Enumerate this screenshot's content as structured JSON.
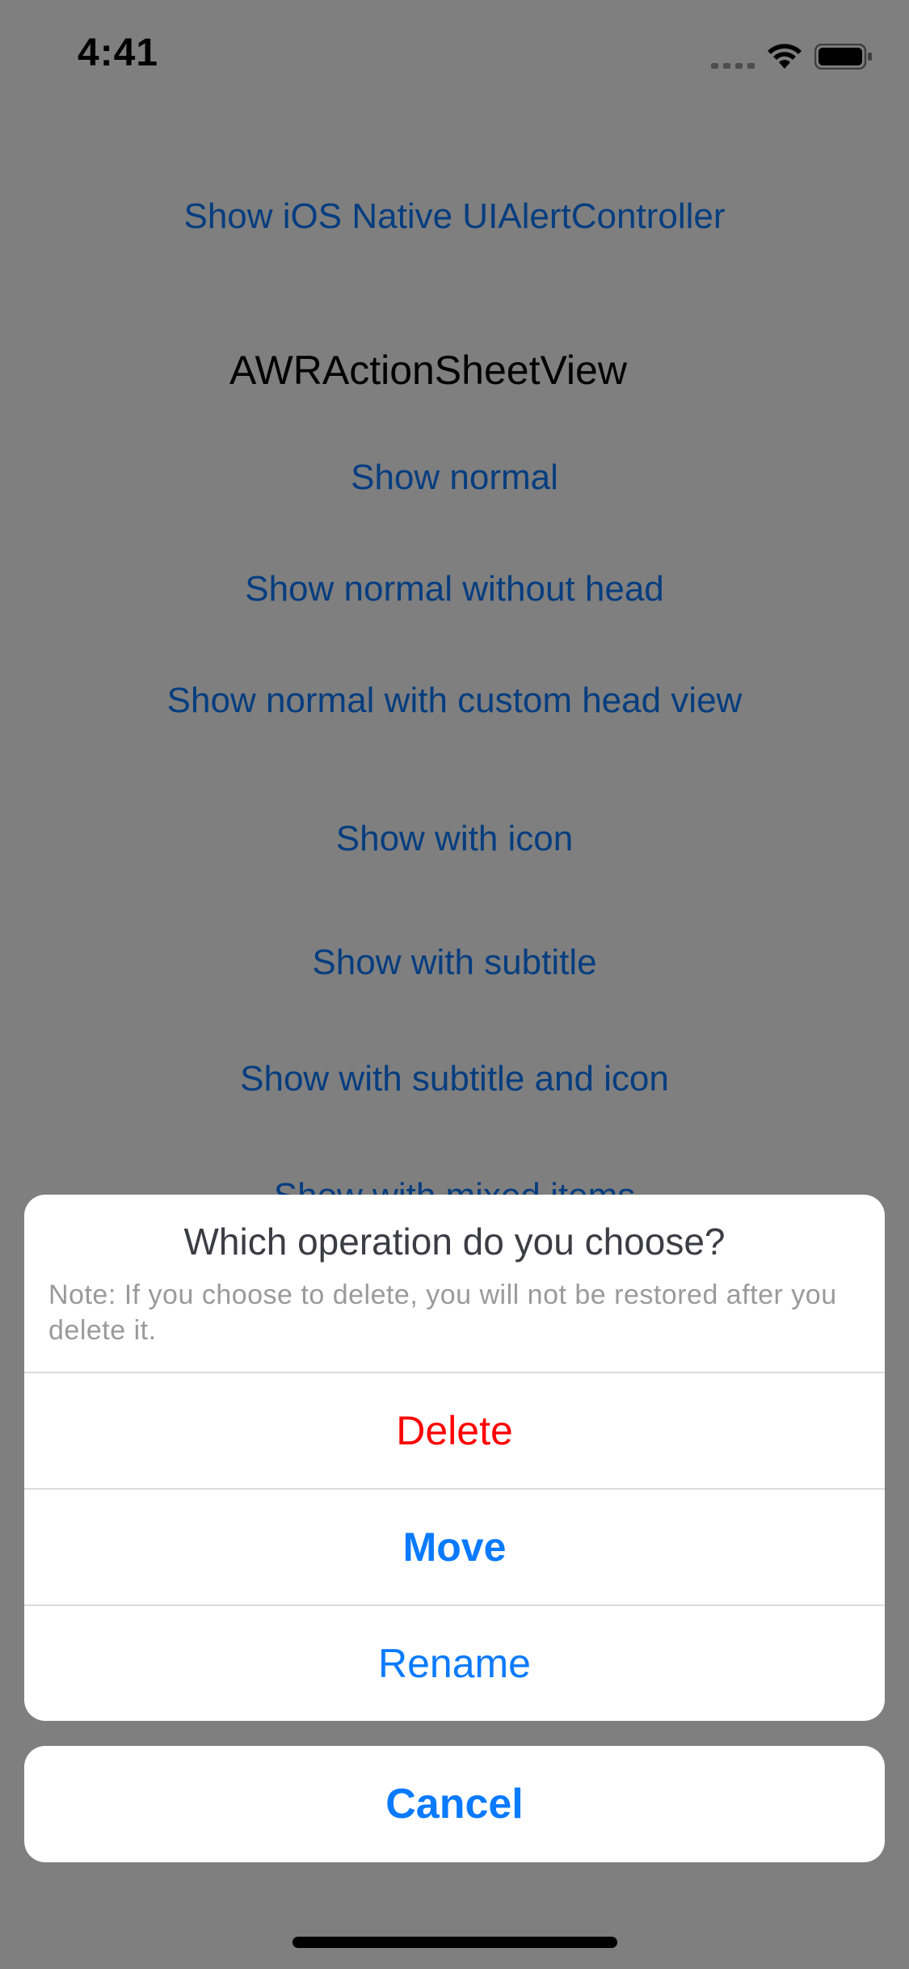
{
  "status_bar": {
    "time": "4:41",
    "icons": [
      "signal-icon",
      "wifi-icon",
      "battery-icon"
    ]
  },
  "main": {
    "native_alert_link": "Show iOS Native UIAlertController",
    "section_title": "AWRActionSheetView",
    "links": [
      "Show normal",
      "Show normal without head",
      "Show normal with custom head view",
      "Show with icon",
      "Show with subtitle",
      "Show with subtitle and icon",
      "Show with mixed items"
    ]
  },
  "action_sheet": {
    "title": "Which operation do you choose?",
    "message": "Note: If you choose to delete, you will not be restored after you delete it.",
    "actions": [
      {
        "label": "Delete",
        "style": "destructive"
      },
      {
        "label": "Move",
        "style": "bold"
      },
      {
        "label": "Rename",
        "style": "default"
      }
    ],
    "cancel_label": "Cancel"
  },
  "colors": {
    "accent": "#0a7aff",
    "destructive": "#ff0000",
    "overlay": "rgba(0,0,0,0.5)"
  }
}
